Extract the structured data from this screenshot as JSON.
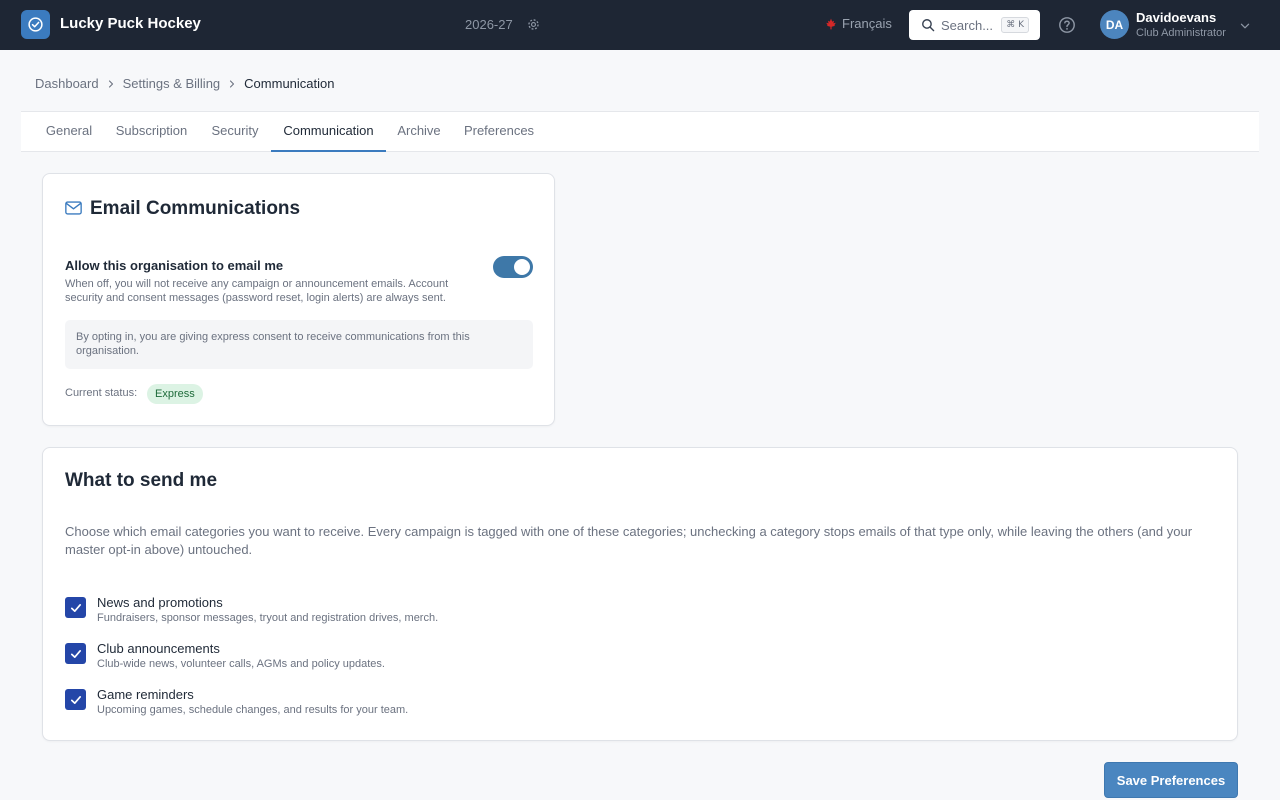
{
  "app": {
    "title": "Lucky Puck Hockey",
    "logo_icon": "check-circle-icon",
    "season": "2026-27",
    "language": "Français",
    "search_placeholder": "Search...",
    "search_shortcut": "⌘ K",
    "user": {
      "initials": "DA",
      "name": "Davidoevans",
      "role": "Club Administrator"
    }
  },
  "breadcrumb": [
    "Dashboard",
    "Settings & Billing",
    "Communication"
  ],
  "tabs": [
    {
      "label": "General",
      "active": false
    },
    {
      "label": "Subscription",
      "active": false
    },
    {
      "label": "Security",
      "active": false
    },
    {
      "label": "Communication",
      "active": true
    },
    {
      "label": "Archive",
      "active": false
    },
    {
      "label": "Preferences",
      "active": false
    }
  ],
  "email_card": {
    "title": "Email Communications",
    "allow_label": "Allow this organisation to email me",
    "allow_description": "When off, you will not receive any campaign or announcement emails. Account security and consent messages (password reset, login alerts) are always sent.",
    "allow_enabled": true,
    "consent_note": "By opting in, you are giving express consent to receive communications from this organisation.",
    "status_label": "Current status:",
    "status_value": "Express"
  },
  "send_card": {
    "title": "What to send me",
    "description": "Choose which email categories you want to receive. Every campaign is tagged with one of these categories; unchecking a category stops emails of that type only, while leaving the others (and your master opt-in above) untouched.",
    "categories": [
      {
        "label": "News and promotions",
        "description": "Fundraisers, sponsor messages, tryout and registration drives, merch.",
        "checked": true
      },
      {
        "label": "Club announcements",
        "description": "Club-wide news, volunteer calls, AGMs and policy updates.",
        "checked": true
      },
      {
        "label": "Game reminders",
        "description": "Upcoming games, schedule changes, and results for your team.",
        "checked": true
      }
    ]
  },
  "save_label": "Save Preferences",
  "colors": {
    "topbar": "#1e2634",
    "accent": "#3b7bbf",
    "checkbox": "#2446a8",
    "toggle": "#3e78a8",
    "badge_bg": "#dcf3e4"
  }
}
